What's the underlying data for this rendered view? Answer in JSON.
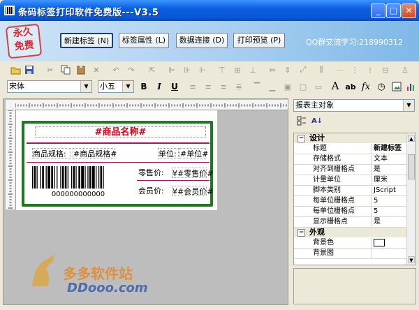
{
  "window": {
    "title": "条码标签打印软件免费版---V3.5",
    "buttons": {
      "minimize": "_",
      "maximize": "□",
      "close": "✕"
    }
  },
  "header": {
    "stamp_text": [
      "永久",
      "免费"
    ],
    "buttons": [
      {
        "label": "新建标签 (N)"
      },
      {
        "label": "标签属性 (L)"
      },
      {
        "label": "数据连接 (D)"
      },
      {
        "label": "打印预览 (P)"
      }
    ],
    "qq_text": "QQ群交流学习:218990312"
  },
  "font_bar": {
    "font_name": "宋体",
    "font_size": "小五",
    "bold": "B",
    "italic": "I",
    "underline": "U",
    "font_icon": "A",
    "ab_icon": "ab"
  },
  "label": {
    "title": "#商品名称#",
    "spec_label": "商品规格:",
    "spec_value": "#商品规格#",
    "unit_label": "单位:",
    "unit_value": "#单位#",
    "retail_label": "零售价:",
    "retail_value": "¥#零售价#",
    "member_label": "会员价:",
    "member_value": "¥#会员价#",
    "barcode_text": "000000000000"
  },
  "props": {
    "object_select": "报表主对象",
    "categories": [
      {
        "name": "设计",
        "rows": [
          {
            "key": "标题",
            "value": "新建标签",
            "bold": true
          },
          {
            "key": "存储格式",
            "value": "文本"
          },
          {
            "key": "对齐到栅格点",
            "value": "是"
          },
          {
            "key": "计量单位",
            "value": "厘米"
          },
          {
            "key": "脚本类别",
            "value": "JScript"
          },
          {
            "key": "每单位栅格点",
            "value": "5"
          },
          {
            "key": "每单位栅格点",
            "value": "5"
          },
          {
            "key": "显示栅格点",
            "value": "是"
          }
        ]
      },
      {
        "name": "外观",
        "rows": [
          {
            "key": "背景色",
            "value": "Window"
          },
          {
            "key": "背景图",
            "value": ""
          }
        ]
      }
    ]
  },
  "watermark": {
    "site": "DDooo.com",
    "brand": "多多软件站"
  },
  "colors": {
    "title_red": "#E0001A",
    "frame_green": "#1F7A1F",
    "xp_blue": "#0A5FE0"
  }
}
